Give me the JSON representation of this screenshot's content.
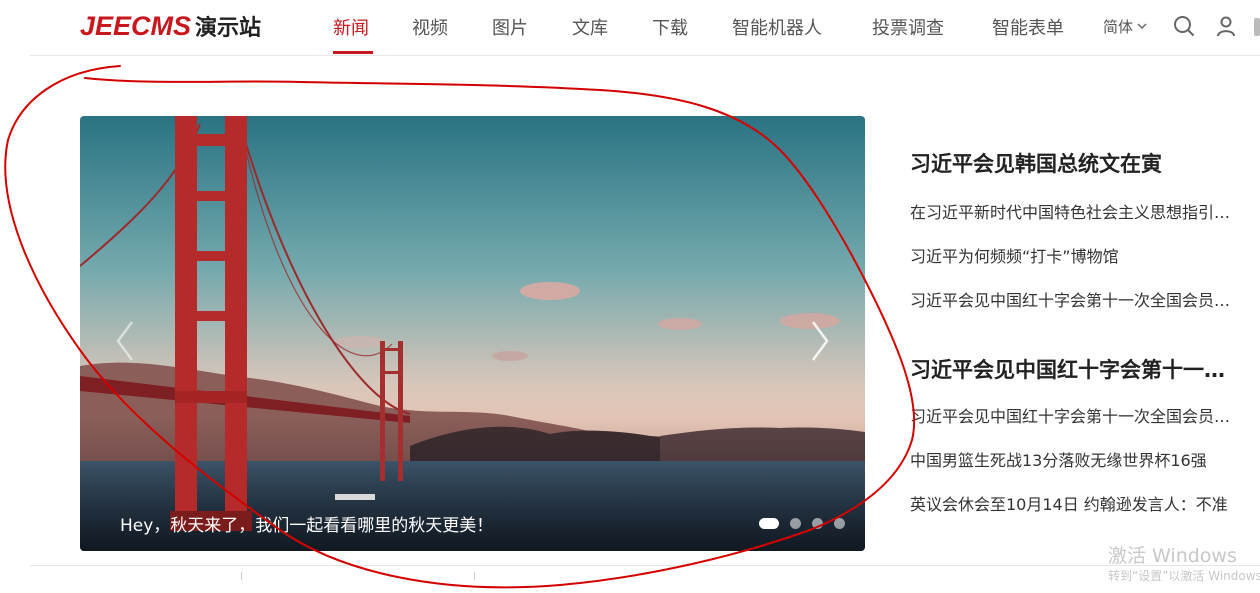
{
  "brand": {
    "en": "JEECMS",
    "cn": "演示站"
  },
  "nav": {
    "items": [
      "新闻",
      "视频",
      "图片",
      "文库",
      "下载",
      "智能机器人",
      "投票调查",
      "智能表单"
    ],
    "active_index": 0,
    "language": "简体"
  },
  "icons": {
    "search": "search-icon",
    "user": "user-icon",
    "language_dropdown": "chevron-down-icon",
    "carousel_prev": "chevron-left-icon",
    "carousel_next": "chevron-right-icon"
  },
  "carousel": {
    "caption": "Hey，秋天来了，我们一起看看哪里的秋天更美！",
    "slide_count": 4,
    "active_slide": 0
  },
  "news": {
    "groups": [
      {
        "headline": "习近平会见韩国总统文在寅",
        "links": [
          "在习近平新时代中国特色社会主义思想指引…",
          "习近平为何频频“打卡”博物馆",
          "习近平会见中国红十字会第十一次全国会员…"
        ]
      },
      {
        "headline": "习近平会见中国红十字会第十一…",
        "links": [
          "习近平会见中国红十字会第十一次全国会员…",
          "中国男篮生死战13分落败无缘世界杯16强",
          "英议会休会至10月14日 约翰逊发言人：不准"
        ]
      }
    ]
  },
  "watermark": {
    "title": "激活 Windows",
    "subtitle": "转到“设置”以激活 Windows。"
  },
  "colors": {
    "accent": "#c9171e",
    "annotation": "#d40000"
  }
}
